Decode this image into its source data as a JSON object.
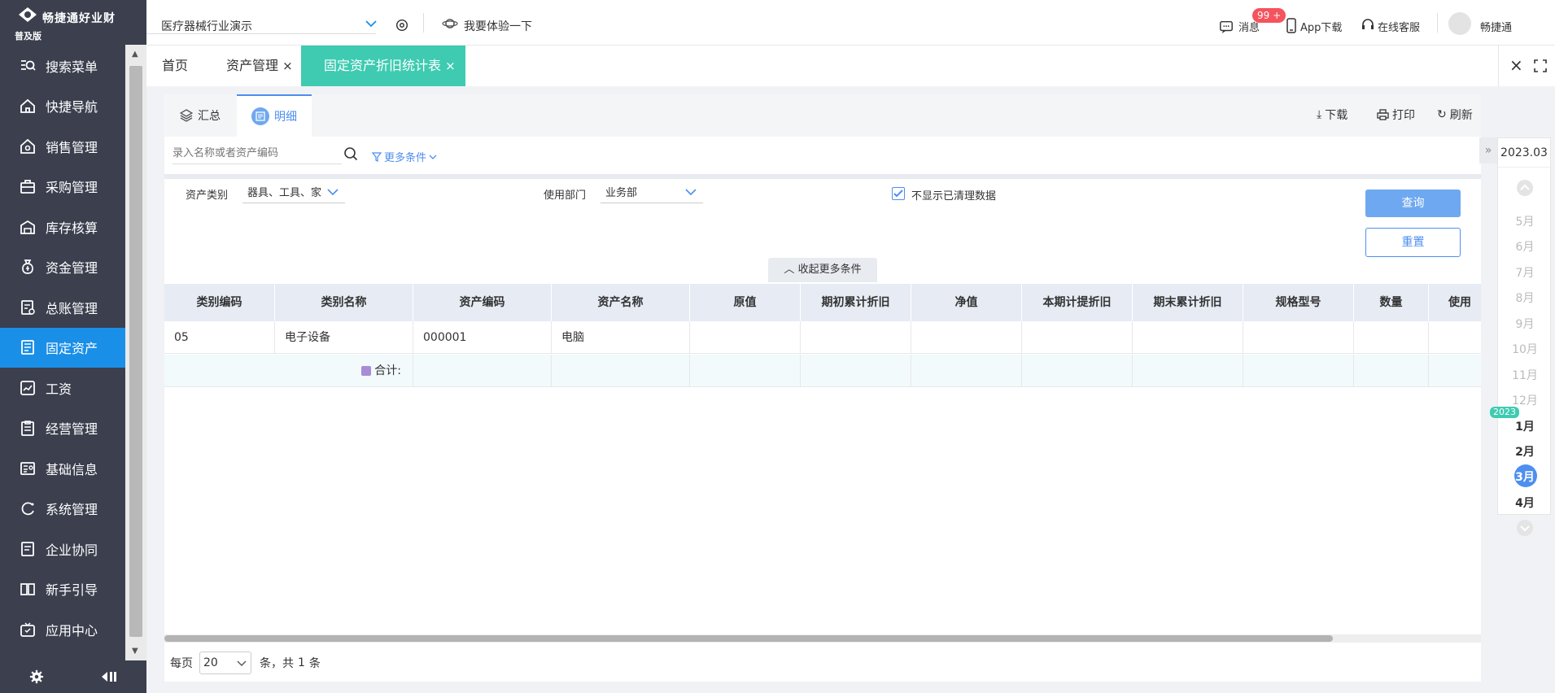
{
  "app": {
    "name": "畅捷通好业财",
    "edition": "普及版"
  },
  "sidebar": {
    "items": [
      {
        "label": "搜索菜单",
        "icon": "search-menu-icon"
      },
      {
        "label": "快捷导航",
        "icon": "home-icon"
      },
      {
        "label": "销售管理",
        "icon": "sales-icon"
      },
      {
        "label": "采购管理",
        "icon": "purchase-icon"
      },
      {
        "label": "库存核算",
        "icon": "warehouse-icon"
      },
      {
        "label": "资金管理",
        "icon": "money-bag-icon"
      },
      {
        "label": "总账管理",
        "icon": "ledger-icon"
      },
      {
        "label": "固定资产",
        "icon": "assets-icon",
        "active": true
      },
      {
        "label": "工资",
        "icon": "payroll-icon"
      },
      {
        "label": "经营管理",
        "icon": "clipboard-icon"
      },
      {
        "label": "基础信息",
        "icon": "id-card-icon"
      },
      {
        "label": "系统管理",
        "icon": "cycle-icon"
      },
      {
        "label": "企业协同",
        "icon": "collab-icon"
      },
      {
        "label": "新手引导",
        "icon": "book-icon"
      },
      {
        "label": "应用中心",
        "icon": "app-center-icon"
      }
    ]
  },
  "topbar": {
    "company": "医疗器械行业演示",
    "trial": "我要体验一下",
    "messages_badge": "99 +",
    "messages": "消息",
    "app_download": "App下载",
    "support": "在线客服",
    "user": "畅捷通"
  },
  "tabs": [
    {
      "label": "首页"
    },
    {
      "label": "资产管理"
    },
    {
      "label": "固定资产折旧统计表",
      "active": true
    }
  ],
  "subtabs": {
    "summary": "汇总",
    "detail": "明细"
  },
  "actions": {
    "download": "下载",
    "print": "打印",
    "refresh": "刷新"
  },
  "search": {
    "placeholder": "录入名称或者资产编码",
    "more": "更多条件"
  },
  "filters": {
    "category_label": "资产类别",
    "category_value": "器具、工具、家",
    "dept_label": "使用部门",
    "dept_value": "业务部",
    "hide_cleared_label": "不显示已清理数据",
    "hide_cleared_checked": true,
    "query": "查询",
    "reset": "重置",
    "collapse": "收起更多条件"
  },
  "table": {
    "columns": [
      "类别编码",
      "类别名称",
      "资产编码",
      "资产名称",
      "原值",
      "期初累计折旧",
      "净值",
      "本期计提折旧",
      "期末累计折旧",
      "规格型号",
      "数量",
      "使用"
    ],
    "rows": [
      [
        "05",
        "电子设备",
        "000001",
        "电脑",
        "",
        "",
        "",
        "",
        "",
        "",
        "",
        ""
      ]
    ],
    "total_label": "合计:"
  },
  "pager": {
    "per_page": "每页",
    "page_size": "20",
    "total_prefix": "条，共",
    "total": "1",
    "total_suffix": "条"
  },
  "period_panel": {
    "current": "2023.03",
    "year_tag": "2023",
    "months_prev": [
      "5月",
      "6月",
      "7月",
      "8月",
      "9月",
      "10月",
      "11月",
      "12月"
    ],
    "months_cur": [
      "1月",
      "2月",
      "3月",
      "4月"
    ],
    "selected": "3月"
  },
  "colors": {
    "accent": "#3ecbb1",
    "primary": "#1a8fe8",
    "sidebar": "#3b3f4e",
    "badge": "#f5535d"
  }
}
